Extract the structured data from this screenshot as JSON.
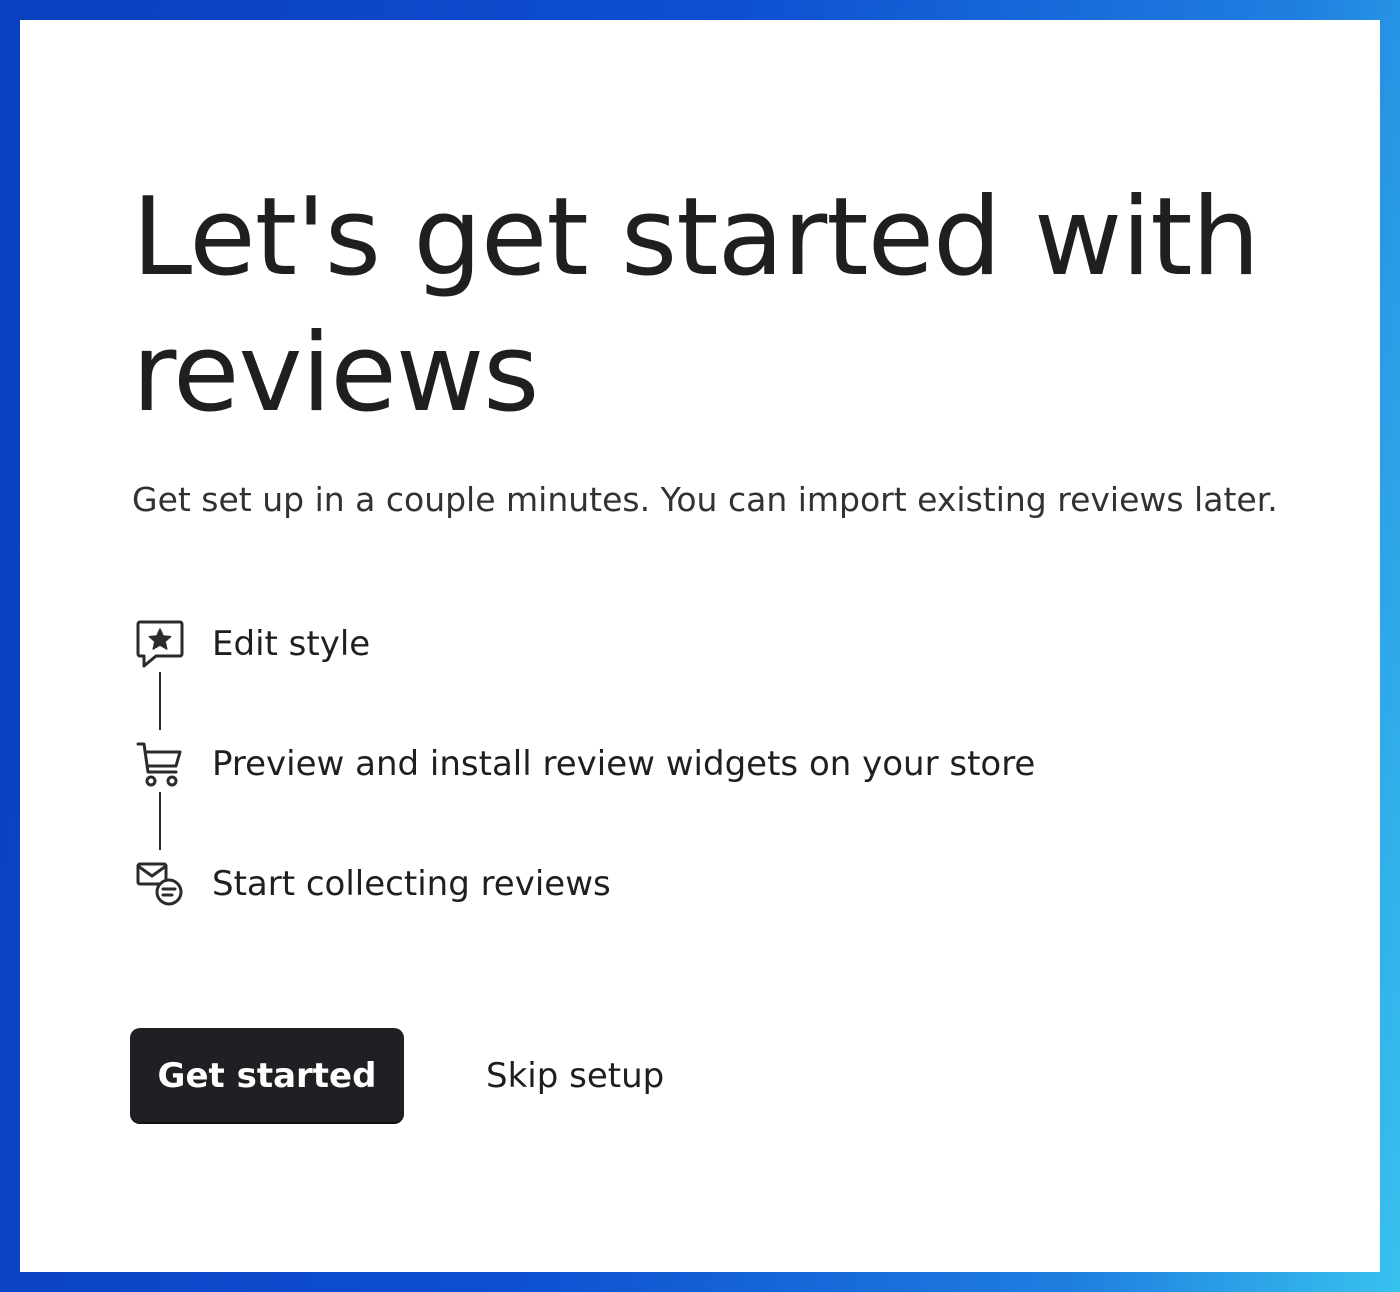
{
  "page": {
    "title": "Let's get started with reviews",
    "subtitle": "Get set up in a couple minutes. You can import existing reviews later."
  },
  "steps": [
    {
      "label": "Edit style",
      "icon": "review-star-chat-icon"
    },
    {
      "label": "Preview and install review widgets on your store",
      "icon": "cart-icon"
    },
    {
      "label": "Start collecting reviews",
      "icon": "email-chat-icon"
    }
  ],
  "actions": {
    "primary_label": "Get started",
    "secondary_label": "Skip setup"
  },
  "colors": {
    "background_gradient_start": "#0a3fbf",
    "background_gradient_end": "#38c2ee",
    "card": "#ffffff",
    "text": "#1e1f21",
    "primary_button": "#1f2023"
  }
}
